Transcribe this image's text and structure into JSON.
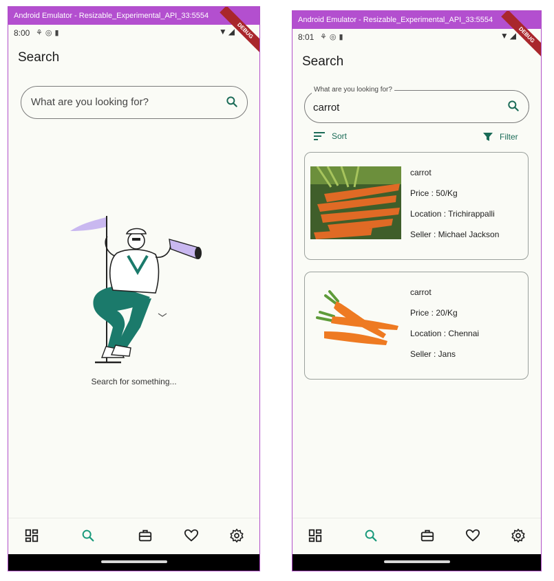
{
  "accent_color": "#1a6b57",
  "left": {
    "window_title": "Android Emulator - Resizable_Experimental_API_33:5554",
    "status_time": "8:00",
    "debug_banner": "DEBUG",
    "page_title": "Search",
    "search": {
      "placeholder": "What are you looking for?"
    },
    "empty_state_text": "Search for something...",
    "nav": [
      "dashboard-icon",
      "search-icon",
      "briefcase-icon",
      "heart-icon",
      "gear-icon"
    ],
    "active_nav": "search"
  },
  "right": {
    "window_title": "Android Emulator - Resizable_Experimental_API_33:5554",
    "status_time": "8:01",
    "debug_banner": "DEBUG",
    "page_title": "Search",
    "search": {
      "label": "What are you looking for?",
      "value": "carrot"
    },
    "sort_label": "Sort",
    "filter_label": "Filter",
    "results": [
      {
        "name": "carrot",
        "price": "Price : 50/Kg",
        "location": "Location : Trichirappalli",
        "seller": "Seller : Michael Jackson"
      },
      {
        "name": "carrot",
        "price": "Price : 20/Kg",
        "location": "Location : Chennai",
        "seller": "Seller : Jans"
      }
    ],
    "active_nav": "search"
  }
}
